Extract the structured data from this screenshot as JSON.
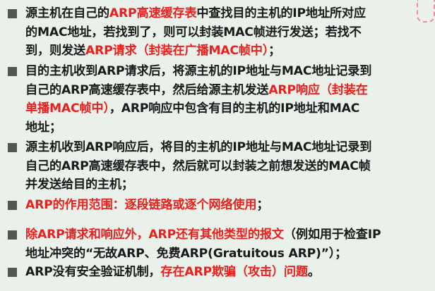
{
  "items": [
    {
      "lines": [
        [
          {
            "t": "源主机在自己的",
            "c": "n"
          },
          {
            "t": "ARP高速缓存表",
            "c": "r"
          },
          {
            "t": "中查找目的主机的IP地址所对应",
            "c": "n"
          }
        ],
        [
          {
            "t": "的MAC地址，若找到了，则可以封装MAC帧进行发送；若找不",
            "c": "n"
          }
        ],
        [
          {
            "t": "到，则发送",
            "c": "n"
          },
          {
            "t": "ARP请求（封装在广播MAC帧中）",
            "c": "r"
          },
          {
            "t": "；",
            "c": "n"
          }
        ]
      ]
    },
    {
      "lines": [
        [
          {
            "t": "目的主机收到ARP请求后，将源主机的IP地址与MAC地址记录到",
            "c": "n"
          }
        ],
        [
          {
            "t": "自己的ARP高速缓存表中，然后给源主机发送",
            "c": "n"
          },
          {
            "t": "ARP响应（封装在",
            "c": "r"
          }
        ],
        [
          {
            "t": "单播MAC帧中）",
            "c": "r"
          },
          {
            "t": "，ARP响应中包含有目的主机的IP地址和MAC",
            "c": "n"
          }
        ],
        [
          {
            "t": "地址；",
            "c": "n"
          }
        ]
      ]
    },
    {
      "lines": [
        [
          {
            "t": "源主机收到ARP响应后，将目的主机的IP地址与MAC地址记录到",
            "c": "n"
          }
        ],
        [
          {
            "t": "自己的ARP高速缓存表中，然后就可以封装之前想发送的MAC帧",
            "c": "n"
          }
        ],
        [
          {
            "t": "并发送给目的主机；",
            "c": "n"
          }
        ]
      ]
    },
    {
      "lines": [
        [
          {
            "t": "ARP的作用范围：逐段链路或逐个网络使用",
            "c": "r"
          },
          {
            "t": "；",
            "c": "n"
          }
        ]
      ]
    },
    {
      "lines": [
        [
          {
            "t": "除ARP请求和响应外，ARP还有其他类型的报文",
            "c": "r"
          },
          {
            "t": "（例如用于检查IP",
            "c": "n"
          }
        ],
        [
          {
            "t": "地址冲突的“无故ARP、免费ARP(Gratuitous ARP)”）；",
            "c": "n"
          }
        ]
      ]
    },
    {
      "lines": [
        [
          {
            "t": "ARP没有安全验证机制，",
            "c": "n"
          },
          {
            "t": "存在ARP欺骗（攻击）问题",
            "c": "r"
          },
          {
            "t": "。",
            "c": "n"
          }
        ]
      ]
    }
  ]
}
